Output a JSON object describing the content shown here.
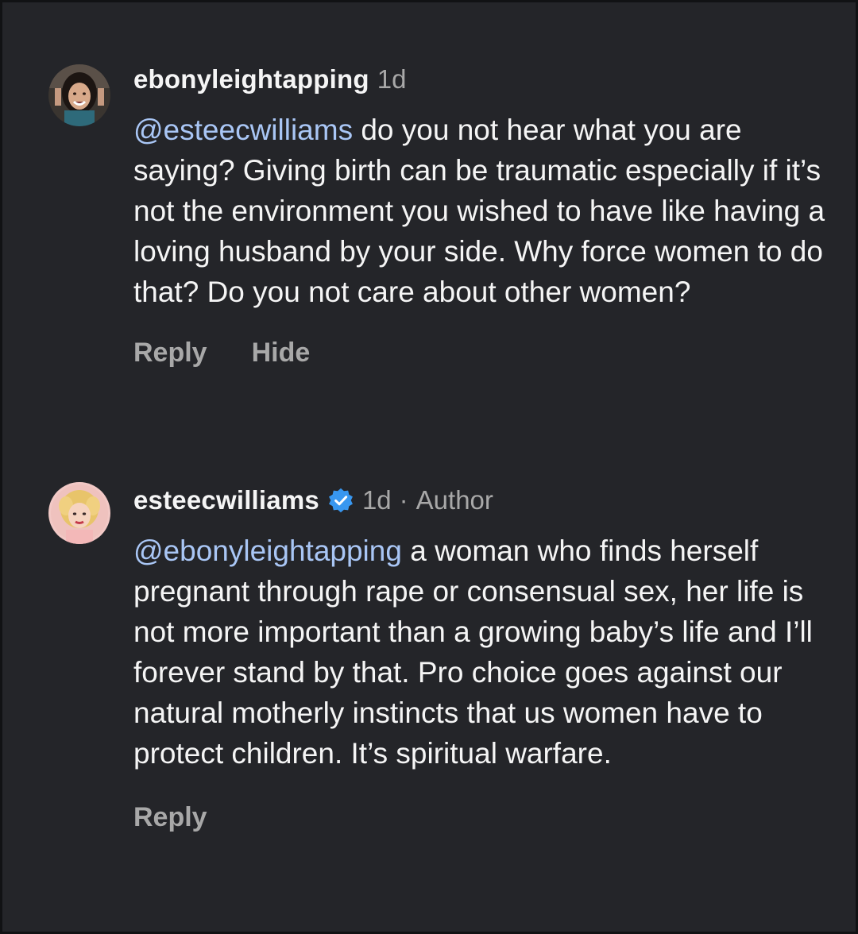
{
  "comments": [
    {
      "avatar": "user-avatar-photo",
      "username": "ebonyleightapping",
      "time": "1d",
      "mention": "@esteecwilliams",
      "text": " do you not hear what you are saying? Giving birth can be traumatic especially if it’s not the environment you wished to have like having a loving husband by your side. Why force women to do that? Do you not care about other women?",
      "reply_label": "Reply",
      "hide_label": "Hide"
    },
    {
      "avatar": "user-avatar-illustration",
      "username": "esteecwilliams",
      "verified_icon": "verified-badge-icon",
      "time": "1d",
      "separator": "·",
      "author_label": "Author",
      "mention": "@ebonyleightapping",
      "text": " a woman who finds herself pregnant through rape or consensual sex, her life is not more important than a growing baby’s life and I’ll forever stand by that. Pro choice goes against our natural motherly instincts that us women have to protect children. It’s spiritual warfare.",
      "reply_label": "Reply"
    }
  ],
  "colors": {
    "background": "#242529",
    "text": "#f5f5f5",
    "muted": "#a8a8a8",
    "mention": "#a9c6f5",
    "verified": "#3897f0"
  }
}
